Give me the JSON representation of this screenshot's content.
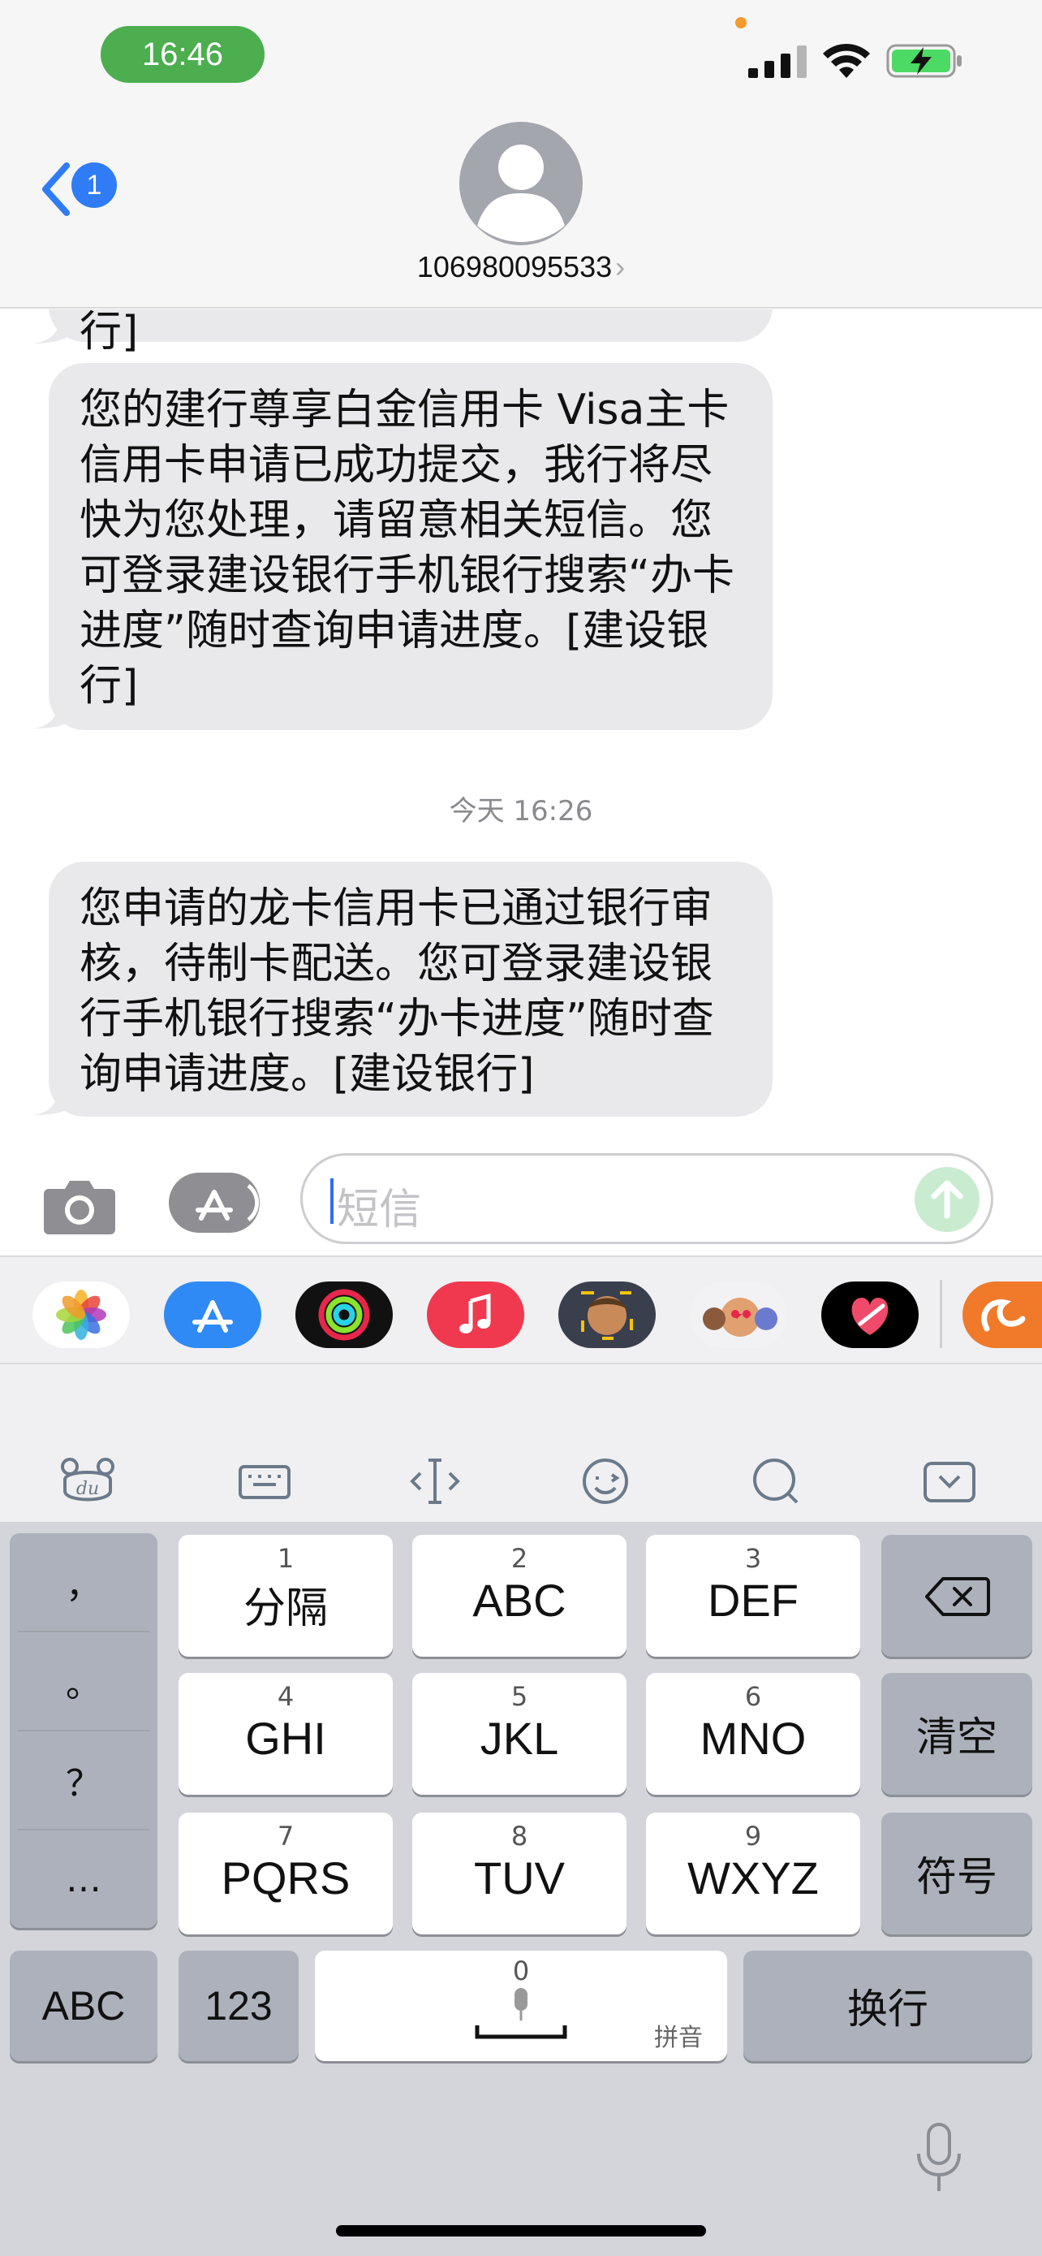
{
  "status_bar": {
    "time": "16:46"
  },
  "header": {
    "back_badge": "1",
    "contact": "106980095533",
    "contact_chevron": "›"
  },
  "messages": {
    "partial_top": "行]",
    "msg1": "您的建行尊享白金信用卡 Visa主卡信用卡申请已成功提交，我行将尽快为您处理，请留意相关短信。您可登录建设银行手机银行搜索“办卡进度”随时查询申请进度。[建设银行]",
    "timestamp": "今天 16:26",
    "msg2": "您申请的龙卡信用卡已通过银行审核，待制卡配送。您可登录建设银行手机银行搜索“办卡进度”随时查询申请进度。[建设银行]"
  },
  "compose": {
    "placeholder": "短信"
  },
  "app_strip": {
    "icons": [
      "photos-icon",
      "app-store-icon",
      "activity-icon",
      "music-icon",
      "memoji-icon",
      "memoji-stickers-icon",
      "digital-touch-icon",
      "uc-browser-icon"
    ]
  },
  "keyboard": {
    "punctuation": [
      "，",
      "。",
      "？",
      "…"
    ],
    "rows": [
      [
        {
          "num": "1",
          "label": "分隔"
        },
        {
          "num": "2",
          "label": "ABC"
        },
        {
          "num": "3",
          "label": "DEF"
        }
      ],
      [
        {
          "num": "4",
          "label": "GHI"
        },
        {
          "num": "5",
          "label": "JKL"
        },
        {
          "num": "6",
          "label": "MNO"
        }
      ],
      [
        {
          "num": "7",
          "label": "PQRS"
        },
        {
          "num": "8",
          "label": "TUV"
        },
        {
          "num": "9",
          "label": "WXYZ"
        }
      ]
    ],
    "clear": "清空",
    "symbols": "符号",
    "abc": "ABC",
    "num123": "123",
    "space_num": "0",
    "space_hint": "拼音",
    "return": "换行"
  },
  "colors": {
    "time_pill": "#4cae4f",
    "accent_blue": "#2f7cf6",
    "bubble": "#e9e9eb",
    "keyboard_bg": "#d3d5db"
  }
}
